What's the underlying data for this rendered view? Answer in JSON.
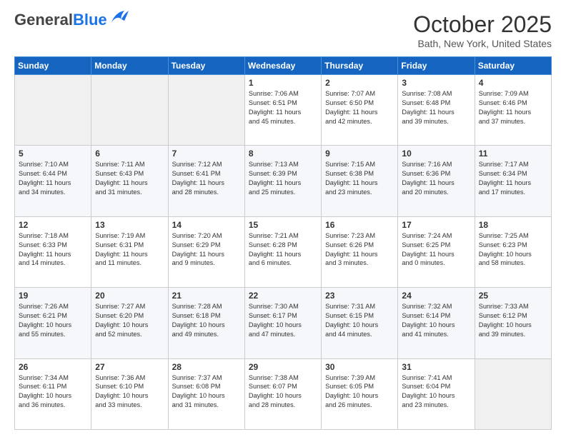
{
  "header": {
    "logo_general": "General",
    "logo_blue": "Blue",
    "month_title": "October 2025",
    "location": "Bath, New York, United States"
  },
  "weekdays": [
    "Sunday",
    "Monday",
    "Tuesday",
    "Wednesday",
    "Thursday",
    "Friday",
    "Saturday"
  ],
  "weeks": [
    [
      {
        "day": "",
        "info": ""
      },
      {
        "day": "",
        "info": ""
      },
      {
        "day": "",
        "info": ""
      },
      {
        "day": "1",
        "info": "Sunrise: 7:06 AM\nSunset: 6:51 PM\nDaylight: 11 hours\nand 45 minutes."
      },
      {
        "day": "2",
        "info": "Sunrise: 7:07 AM\nSunset: 6:50 PM\nDaylight: 11 hours\nand 42 minutes."
      },
      {
        "day": "3",
        "info": "Sunrise: 7:08 AM\nSunset: 6:48 PM\nDaylight: 11 hours\nand 39 minutes."
      },
      {
        "day": "4",
        "info": "Sunrise: 7:09 AM\nSunset: 6:46 PM\nDaylight: 11 hours\nand 37 minutes."
      }
    ],
    [
      {
        "day": "5",
        "info": "Sunrise: 7:10 AM\nSunset: 6:44 PM\nDaylight: 11 hours\nand 34 minutes."
      },
      {
        "day": "6",
        "info": "Sunrise: 7:11 AM\nSunset: 6:43 PM\nDaylight: 11 hours\nand 31 minutes."
      },
      {
        "day": "7",
        "info": "Sunrise: 7:12 AM\nSunset: 6:41 PM\nDaylight: 11 hours\nand 28 minutes."
      },
      {
        "day": "8",
        "info": "Sunrise: 7:13 AM\nSunset: 6:39 PM\nDaylight: 11 hours\nand 25 minutes."
      },
      {
        "day": "9",
        "info": "Sunrise: 7:15 AM\nSunset: 6:38 PM\nDaylight: 11 hours\nand 23 minutes."
      },
      {
        "day": "10",
        "info": "Sunrise: 7:16 AM\nSunset: 6:36 PM\nDaylight: 11 hours\nand 20 minutes."
      },
      {
        "day": "11",
        "info": "Sunrise: 7:17 AM\nSunset: 6:34 PM\nDaylight: 11 hours\nand 17 minutes."
      }
    ],
    [
      {
        "day": "12",
        "info": "Sunrise: 7:18 AM\nSunset: 6:33 PM\nDaylight: 11 hours\nand 14 minutes."
      },
      {
        "day": "13",
        "info": "Sunrise: 7:19 AM\nSunset: 6:31 PM\nDaylight: 11 hours\nand 11 minutes."
      },
      {
        "day": "14",
        "info": "Sunrise: 7:20 AM\nSunset: 6:29 PM\nDaylight: 11 hours\nand 9 minutes."
      },
      {
        "day": "15",
        "info": "Sunrise: 7:21 AM\nSunset: 6:28 PM\nDaylight: 11 hours\nand 6 minutes."
      },
      {
        "day": "16",
        "info": "Sunrise: 7:23 AM\nSunset: 6:26 PM\nDaylight: 11 hours\nand 3 minutes."
      },
      {
        "day": "17",
        "info": "Sunrise: 7:24 AM\nSunset: 6:25 PM\nDaylight: 11 hours\nand 0 minutes."
      },
      {
        "day": "18",
        "info": "Sunrise: 7:25 AM\nSunset: 6:23 PM\nDaylight: 10 hours\nand 58 minutes."
      }
    ],
    [
      {
        "day": "19",
        "info": "Sunrise: 7:26 AM\nSunset: 6:21 PM\nDaylight: 10 hours\nand 55 minutes."
      },
      {
        "day": "20",
        "info": "Sunrise: 7:27 AM\nSunset: 6:20 PM\nDaylight: 10 hours\nand 52 minutes."
      },
      {
        "day": "21",
        "info": "Sunrise: 7:28 AM\nSunset: 6:18 PM\nDaylight: 10 hours\nand 49 minutes."
      },
      {
        "day": "22",
        "info": "Sunrise: 7:30 AM\nSunset: 6:17 PM\nDaylight: 10 hours\nand 47 minutes."
      },
      {
        "day": "23",
        "info": "Sunrise: 7:31 AM\nSunset: 6:15 PM\nDaylight: 10 hours\nand 44 minutes."
      },
      {
        "day": "24",
        "info": "Sunrise: 7:32 AM\nSunset: 6:14 PM\nDaylight: 10 hours\nand 41 minutes."
      },
      {
        "day": "25",
        "info": "Sunrise: 7:33 AM\nSunset: 6:12 PM\nDaylight: 10 hours\nand 39 minutes."
      }
    ],
    [
      {
        "day": "26",
        "info": "Sunrise: 7:34 AM\nSunset: 6:11 PM\nDaylight: 10 hours\nand 36 minutes."
      },
      {
        "day": "27",
        "info": "Sunrise: 7:36 AM\nSunset: 6:10 PM\nDaylight: 10 hours\nand 33 minutes."
      },
      {
        "day": "28",
        "info": "Sunrise: 7:37 AM\nSunset: 6:08 PM\nDaylight: 10 hours\nand 31 minutes."
      },
      {
        "day": "29",
        "info": "Sunrise: 7:38 AM\nSunset: 6:07 PM\nDaylight: 10 hours\nand 28 minutes."
      },
      {
        "day": "30",
        "info": "Sunrise: 7:39 AM\nSunset: 6:05 PM\nDaylight: 10 hours\nand 26 minutes."
      },
      {
        "day": "31",
        "info": "Sunrise: 7:41 AM\nSunset: 6:04 PM\nDaylight: 10 hours\nand 23 minutes."
      },
      {
        "day": "",
        "info": ""
      }
    ]
  ]
}
